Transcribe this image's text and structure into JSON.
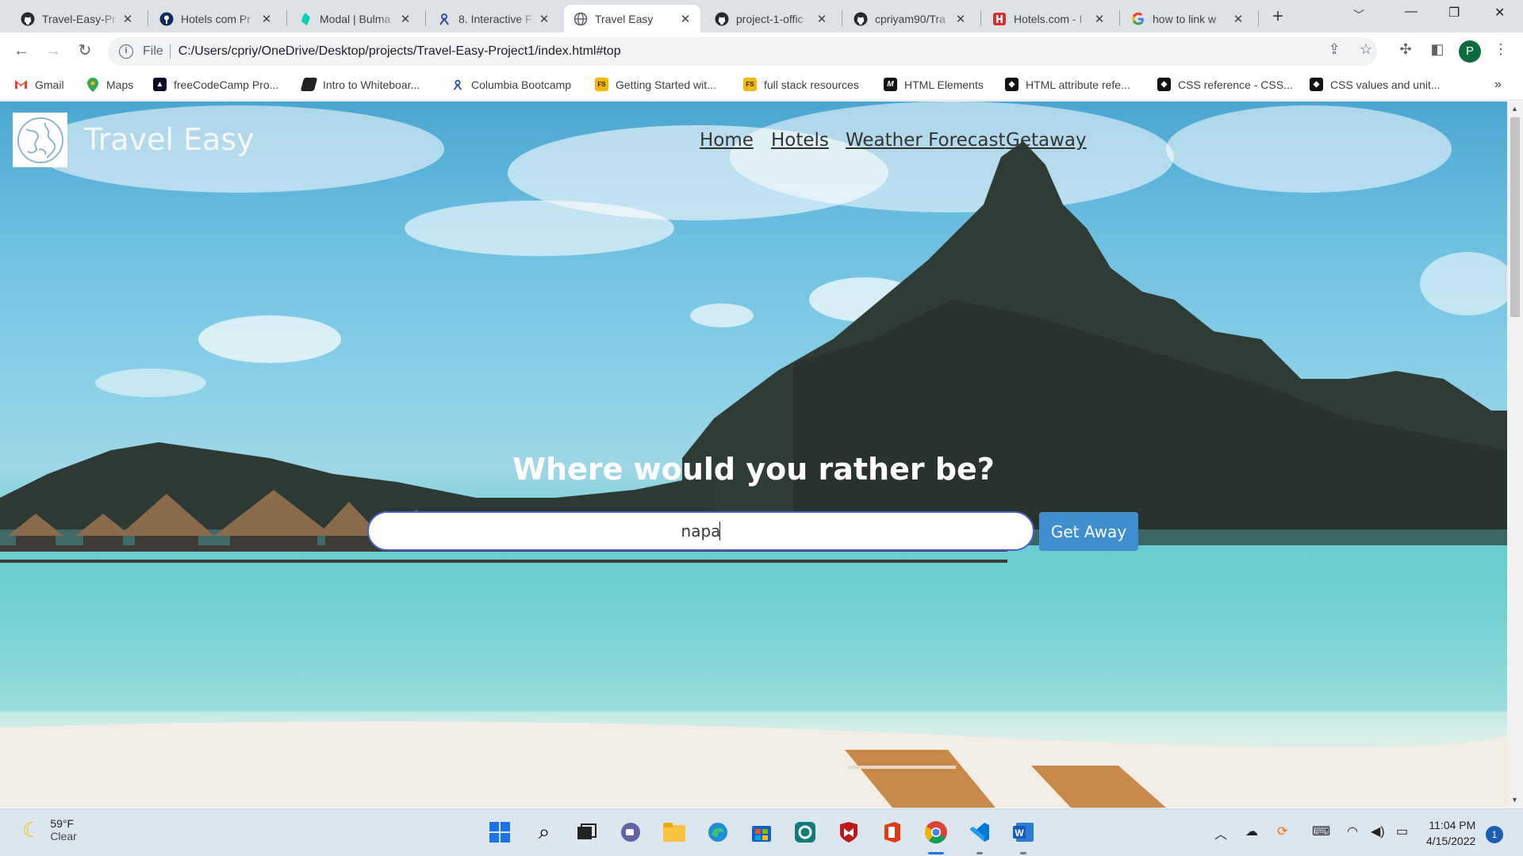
{
  "browser": {
    "tabs": [
      {
        "title": "Travel-Easy-Pr",
        "icon": "github-icon"
      },
      {
        "title": "Hotels com Pr",
        "icon": "rapidapi-icon"
      },
      {
        "title": "Modal | Bulma",
        "icon": "bulma-icon"
      },
      {
        "title": "8. Interactive F",
        "icon": "bootcamp-icon"
      },
      {
        "title": "Travel Easy",
        "icon": "globe-icon",
        "active": true
      },
      {
        "title": "project-1-offic",
        "icon": "github-icon"
      },
      {
        "title": "cpriyam90/Tra",
        "icon": "github-icon"
      },
      {
        "title": "Hotels.com - I",
        "icon": "hotels-icon"
      },
      {
        "title": "how to link w",
        "icon": "google-icon"
      }
    ],
    "address": {
      "scheme_label": "File",
      "url": "C:/Users/cpriy/OneDrive/Desktop/projects/Travel-Easy-Project1/index.html#top"
    },
    "profile_initial": "P",
    "bookmarks": [
      {
        "label": "Gmail",
        "icon": "gmail-icon"
      },
      {
        "label": "Maps",
        "icon": "maps-icon"
      },
      {
        "label": "freeCodeCamp Pro...",
        "icon": "freecodecamp-icon"
      },
      {
        "label": "Intro to Whiteboar...",
        "icon": "whiteboard-icon"
      },
      {
        "label": "Columbia Bootcamp",
        "icon": "bootcamp-icon"
      },
      {
        "label": "Getting Started wit...",
        "icon": "fs-icon"
      },
      {
        "label": "full stack resources",
        "icon": "fs-icon"
      },
      {
        "label": "HTML Elements",
        "icon": "mdn-icon"
      },
      {
        "label": "HTML attribute refe...",
        "icon": "w3-icon"
      },
      {
        "label": "CSS reference - CSS...",
        "icon": "w3-icon"
      },
      {
        "label": "CSS values and unit...",
        "icon": "w3-icon"
      }
    ],
    "more_bookmarks": "»"
  },
  "page": {
    "brand": "Travel Easy",
    "nav": [
      "Home",
      "Hotels",
      "Weather Forecast",
      "Getaway"
    ],
    "headline": "Where would you rather be?",
    "search": {
      "value": "napa",
      "placeholder": ""
    },
    "button": "Get Away"
  },
  "taskbar": {
    "weather": {
      "temp": "59°F",
      "condition": "Clear"
    },
    "time": "11:04 PM",
    "date": "4/15/2022",
    "notifications": "1"
  }
}
